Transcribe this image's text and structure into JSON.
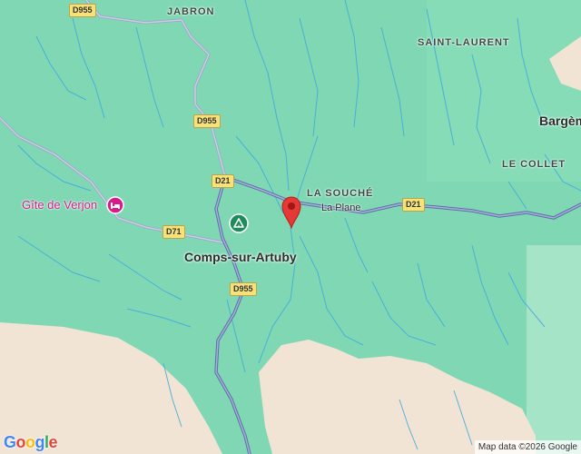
{
  "map": {
    "localities": {
      "jabron": "JABRON",
      "saint_laurent": "SAINT-LAURENT",
      "le_collet": "LE COLLET",
      "la_souche": "LA SOUCHÉ"
    },
    "town": "Comps-sur-Artuby",
    "town_partial": "Bargèm",
    "hamlet": "La Plane",
    "poi": {
      "name": "Gîte de Verjon",
      "icon": "lodging-icon",
      "color": "#d81b8c"
    },
    "park_icon": "campground-icon",
    "roads": [
      "D955",
      "D955",
      "D21",
      "D71",
      "D955",
      "D21"
    ],
    "pin": {
      "icon": "location-pin-icon",
      "color": "#e53935"
    },
    "attribution": "Map data ©2026 Google",
    "logo": "Google",
    "colors": {
      "forest": "#7fd8b3",
      "terrain": "#f2e6d6",
      "water": "#41a9e0",
      "road": "#8f9ec7"
    }
  }
}
